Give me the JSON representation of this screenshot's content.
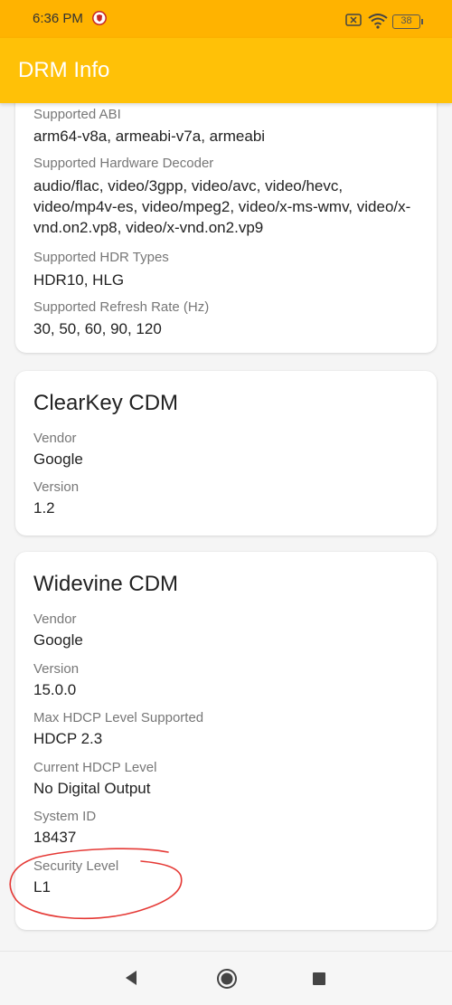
{
  "status_bar": {
    "time": "6:36 PM",
    "battery": "38",
    "icons": [
      "brave-icon",
      "sim-icon",
      "wifi-icon",
      "battery-icon"
    ]
  },
  "app_bar": {
    "title": "DRM Info",
    "color": "#ffc107"
  },
  "device_card": {
    "fields": [
      {
        "label": "Supported ABI",
        "value": "arm64-v8a, armeabi-v7a, armeabi"
      },
      {
        "label": "Supported Hardware Decoder",
        "value": "audio/flac, video/3gpp, video/avc, video/hevc, video/mp4v-es, video/mpeg2, video/x-ms-wmv, video/x-vnd.on2.vp8, video/x-vnd.on2.vp9"
      },
      {
        "label": "Supported HDR Types",
        "value": "HDR10, HLG"
      },
      {
        "label": "Supported Refresh Rate (Hz)",
        "value": "30, 50, 60, 90, 120"
      }
    ]
  },
  "clearkey_card": {
    "title": "ClearKey CDM",
    "fields": [
      {
        "label": "Vendor",
        "value": "Google"
      },
      {
        "label": "Version",
        "value": "1.2"
      }
    ]
  },
  "widevine_card": {
    "title": "Widevine CDM",
    "fields": [
      {
        "label": "Vendor",
        "value": "Google"
      },
      {
        "label": "Version",
        "value": "15.0.0"
      },
      {
        "label": "Max HDCP Level Supported",
        "value": "HDCP 2.3"
      },
      {
        "label": "Current HDCP Level",
        "value": "No Digital Output"
      },
      {
        "label": "System ID",
        "value": "18437"
      },
      {
        "label": "Security Level",
        "value": "L1"
      }
    ]
  },
  "annotation": {
    "color": "#e53935",
    "shape": "hand-drawn ellipse around Security Level"
  },
  "nav_bar": {
    "icons": [
      "back-icon",
      "home-icon",
      "recents-icon"
    ]
  }
}
